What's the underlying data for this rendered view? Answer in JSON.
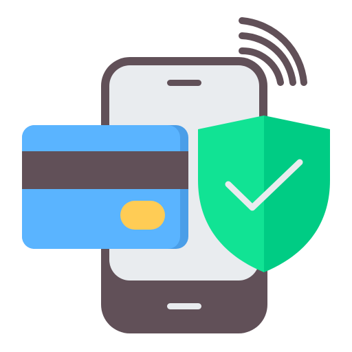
{
  "illustration": {
    "icons": [
      "wireless-signal-icon",
      "smartphone-icon",
      "credit-card-icon",
      "security-shield-icon",
      "checkmark-icon"
    ],
    "colors": {
      "outline_dark": "#615058",
      "phone_screen": "#e9ecef",
      "card_blue": "#5ab4ff",
      "card_blue_shadow": "#4a9ee8",
      "card_stripe": "#615058",
      "card_chip": "#ffcc55",
      "shield_light": "#11e394",
      "shield_dark": "#00cc84",
      "check_mark": "#e9ecef",
      "background": "#ffffff"
    }
  }
}
